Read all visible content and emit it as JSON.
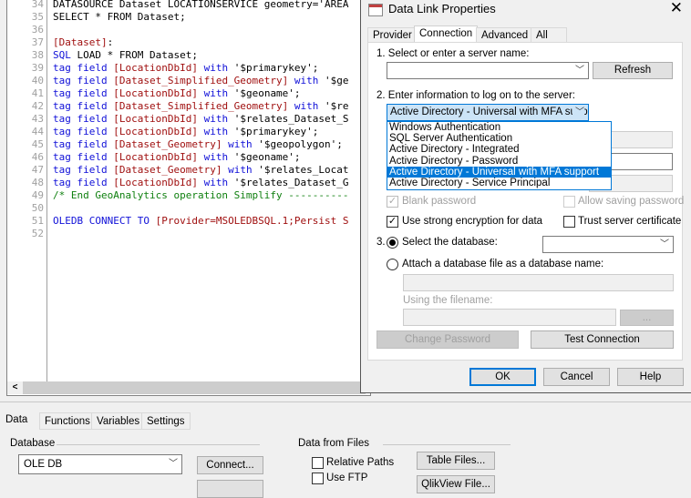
{
  "editor": {
    "lines": [
      {
        "n": "34",
        "t": [
          [
            "st",
            "DATASOURCE Dataset LOCATIONSERVICE geometry='AREA"
          ]
        ]
      },
      {
        "n": "35",
        "t": [
          [
            "st",
            "SELECT * FROM Dataset;"
          ]
        ]
      },
      {
        "n": "36",
        "t": []
      },
      {
        "n": "37",
        "t": [
          [
            "fld",
            "[Dataset]"
          ],
          [
            "st",
            ":"
          ]
        ]
      },
      {
        "n": "38",
        "t": [
          [
            "kw",
            "SQL"
          ],
          [
            "st",
            " LOAD * FROM Dataset;"
          ]
        ]
      },
      {
        "n": "39",
        "t": [
          [
            "kw",
            "tag field "
          ],
          [
            "fld",
            "[LocationDbId]"
          ],
          [
            "kw",
            " with "
          ],
          [
            "st",
            "'$primarykey';"
          ]
        ]
      },
      {
        "n": "40",
        "t": [
          [
            "kw",
            "tag field "
          ],
          [
            "fld",
            "[Dataset_Simplified_Geometry]"
          ],
          [
            "kw",
            " with "
          ],
          [
            "st",
            "'$ge"
          ]
        ]
      },
      {
        "n": "41",
        "t": [
          [
            "kw",
            "tag field "
          ],
          [
            "fld",
            "[LocationDbId]"
          ],
          [
            "kw",
            " with "
          ],
          [
            "st",
            "'$geoname';"
          ]
        ]
      },
      {
        "n": "42",
        "t": [
          [
            "kw",
            "tag field "
          ],
          [
            "fld",
            "[Dataset_Simplified_Geometry]"
          ],
          [
            "kw",
            " with "
          ],
          [
            "st",
            "'$re"
          ]
        ]
      },
      {
        "n": "43",
        "t": [
          [
            "kw",
            "tag field "
          ],
          [
            "fld",
            "[LocationDbId]"
          ],
          [
            "kw",
            " with "
          ],
          [
            "st",
            "'$relates_Dataset_S"
          ]
        ]
      },
      {
        "n": "44",
        "t": [
          [
            "kw",
            "tag field "
          ],
          [
            "fld",
            "[LocationDbId]"
          ],
          [
            "kw",
            " with "
          ],
          [
            "st",
            "'$primarykey';"
          ]
        ]
      },
      {
        "n": "45",
        "t": [
          [
            "kw",
            "tag field "
          ],
          [
            "fld",
            "[Dataset_Geometry]"
          ],
          [
            "kw",
            " with "
          ],
          [
            "st",
            "'$geopolygon';"
          ]
        ]
      },
      {
        "n": "46",
        "t": [
          [
            "kw",
            "tag field "
          ],
          [
            "fld",
            "[LocationDbId]"
          ],
          [
            "kw",
            " with "
          ],
          [
            "st",
            "'$geoname';"
          ]
        ]
      },
      {
        "n": "47",
        "t": [
          [
            "kw",
            "tag field "
          ],
          [
            "fld",
            "[Dataset_Geometry]"
          ],
          [
            "kw",
            " with "
          ],
          [
            "st",
            "'$relates_Locat"
          ]
        ]
      },
      {
        "n": "48",
        "t": [
          [
            "kw",
            "tag field "
          ],
          [
            "fld",
            "[LocationDbId]"
          ],
          [
            "kw",
            " with "
          ],
          [
            "st",
            "'$relates_Dataset_G"
          ]
        ]
      },
      {
        "n": "49",
        "t": [
          [
            "cm",
            "/* End GeoAnalytics operation Simplify ----------"
          ]
        ]
      },
      {
        "n": "50",
        "t": []
      },
      {
        "n": "51",
        "t": [
          [
            "kw",
            "OLEDB CONNECT TO "
          ],
          [
            "fld",
            "[Provider=MSOLEDBSQL.1;Persist S"
          ]
        ]
      },
      {
        "n": "52",
        "t": []
      }
    ]
  },
  "dialog": {
    "title": "Data Link Properties",
    "tabs": [
      "Provider",
      "Connection",
      "Advanced",
      "All"
    ],
    "step1": "1. Select or enter a server name:",
    "server_value": "",
    "refresh": "Refresh",
    "step2": "2. Enter information to log on to the server:",
    "auth_selected": "Active Directory - Universal with MFA supp",
    "auth_options": [
      "Windows Authentication",
      "SQL Server Authentication",
      "Active Directory - Integrated",
      "Active Directory - Password",
      "Active Directory - Universal with MFA support",
      "Active Directory - Service Principal"
    ],
    "auth_highlighted": 4,
    "blank_password": "Blank password",
    "allow_saving": "Allow saving password",
    "strong_encryption": "Use strong encryption for data",
    "trust_cert": "Trust server certificate",
    "step3": "3.",
    "select_db": "Select the database:",
    "attach_db": "Attach a database file as a database name:",
    "using_filename": "Using the filename:",
    "browse": "...",
    "change_password": "Change Password",
    "test_connection": "Test Connection",
    "ok": "OK",
    "cancel": "Cancel",
    "help": "Help"
  },
  "bottom": {
    "tabs": [
      "Data",
      "Functions",
      "Variables",
      "Settings"
    ],
    "database_label": "Database",
    "database_value": "OLE DB",
    "connect": "Connect...",
    "files_label": "Data from Files",
    "relative_paths": "Relative Paths",
    "use_ftp": "Use FTP",
    "table_files": "Table Files...",
    "qlikview_file": "QlikView File..."
  },
  "colors": {
    "keyword": "#1010d8",
    "field": "#a01010",
    "comment": "#108010",
    "highlight": "#0078d7"
  }
}
